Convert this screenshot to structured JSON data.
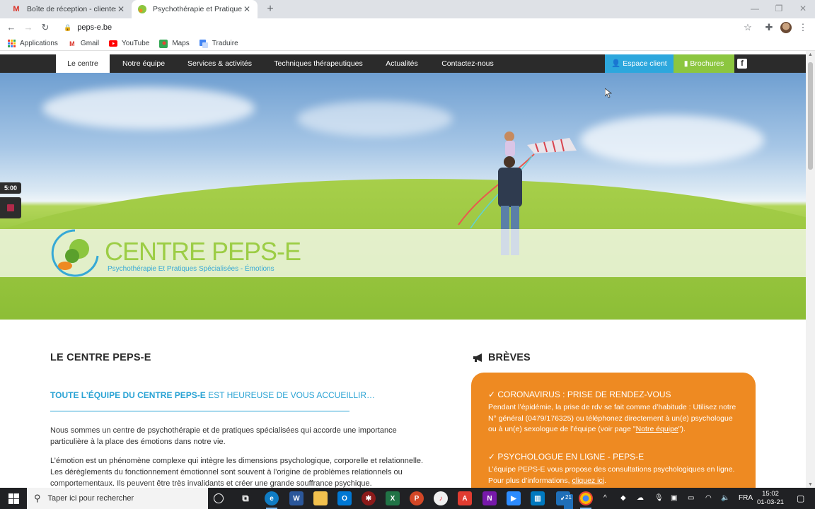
{
  "browser": {
    "tabs": [
      {
        "title": "Boîte de réception - clientespace",
        "favicon": "gmail-icon"
      },
      {
        "title": "Psychothérapie et Pratiques Spécialisées",
        "favicon": "peps-e-icon"
      }
    ],
    "url": "peps-e.be",
    "bookmarks": [
      {
        "label": "Applications",
        "icon": "apps-grid-icon"
      },
      {
        "label": "Gmail",
        "icon": "gmail-icon"
      },
      {
        "label": "YouTube",
        "icon": "youtube-icon"
      },
      {
        "label": "Maps",
        "icon": "maps-icon"
      },
      {
        "label": "Traduire",
        "icon": "translate-icon"
      }
    ]
  },
  "site": {
    "nav": [
      "Le centre",
      "Notre équipe",
      "Services & activités",
      "Techniques thérapeutiques",
      "Actualités",
      "Contactez-nous"
    ],
    "active_nav": "Le centre",
    "espace_client": "Espace client",
    "brochures": "Brochures",
    "logo_title": "CENTRE PEPS-E",
    "logo_subtitle": "Psychothérapie Et Pratiques Spécialisées - Émotions",
    "colors": {
      "accent_blue": "#2da7dd",
      "accent_green": "#8cc63f",
      "orange": "#ee8a22",
      "nav_bg": "#2b2b2b"
    }
  },
  "content": {
    "heading": "LE CENTRE PEPS-E",
    "tagline_bold": "TOUTE L’ÉQUIPE DU CENTRE PEPS-E",
    "tagline_rest": " EST HEUREUSE DE VOUS ACCUEILLIR…",
    "para1": "Nous sommes un centre de psychothérapie et de pratiques spécialisées qui accorde une importance particulière à la place des émotions dans notre vie.",
    "para2": "L’émotion est un phénomène complexe qui intègre les dimensions psychologique, corporelle et relationnelle. Les dérèglements du fonctionnement émotionnel sont souvent à l’origine de problèmes relationnels ou comportementaux. Ils peuvent être très invalidants et créer une grande souffrance psychique."
  },
  "breves": {
    "heading": "BRÈVES",
    "items": [
      {
        "title": "✓ CORONAVIRUS : PRISE DE RENDEZ-VOUS",
        "text": "Pendant l’épidémie, la prise de rdv se fait comme d’habitude : Utilisez notre N° général (0479/176325) ou téléphonez directement à un(e) psychologue ou à un(e) sexologue de l’équipe (voir page \"",
        "link": "Notre équipe",
        "text_end": "\")."
      },
      {
        "title": "✓ PSYCHOLOGUE EN LIGNE - PEPS-E",
        "text": "L’équipe PEPS-E vous propose des consultations psychologiques en ligne. Pour plus d’informations, ",
        "link": "cliquez ici",
        "text_end": "."
      }
    ]
  },
  "recorder": {
    "time": "5:00"
  },
  "taskbar": {
    "search_placeholder": "Taper ici pour rechercher",
    "language": "FRA",
    "time": "15:02",
    "date": "01-03-21",
    "badge": "21"
  }
}
